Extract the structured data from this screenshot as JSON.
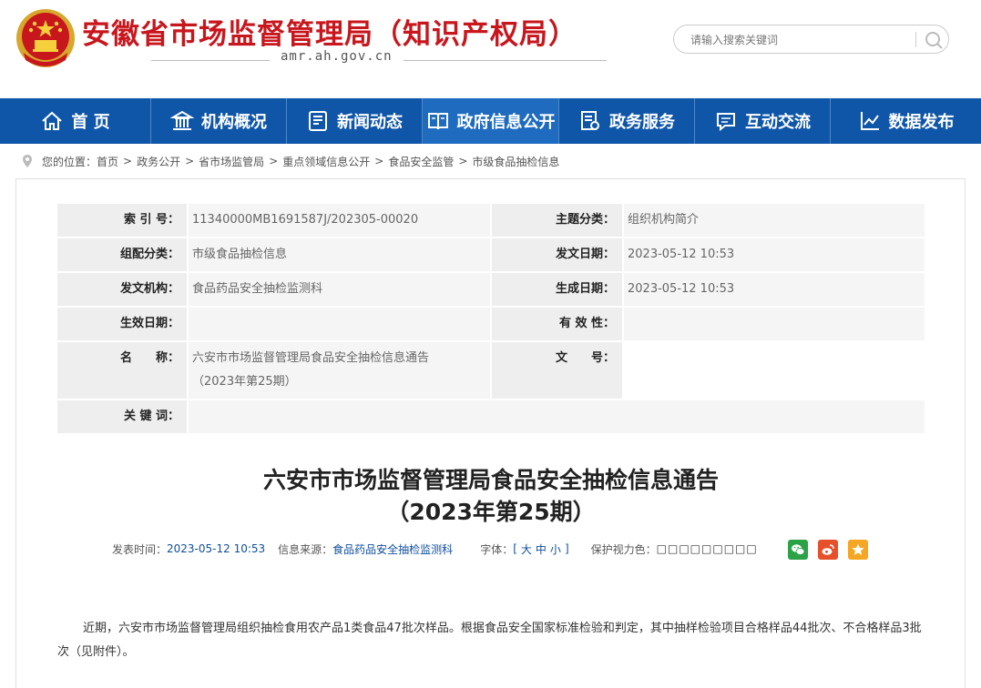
{
  "header": {
    "title": "安徽省市场监督管理局（知识产权局）",
    "domain": "amr.ah.gov.cn",
    "search_placeholder": "请输入搜索关键词",
    "brand_color": "#c8161d"
  },
  "nav": {
    "color": "#0f56a9",
    "items": [
      {
        "label": "首 页",
        "icon": "home-icon"
      },
      {
        "label": "机构概况",
        "icon": "building-icon"
      },
      {
        "label": "新闻动态",
        "icon": "news-icon"
      },
      {
        "label": "政府信息公开",
        "icon": "book-icon"
      },
      {
        "label": "政务服务",
        "icon": "document-icon"
      },
      {
        "label": "互动交流",
        "icon": "chat-icon"
      },
      {
        "label": "数据发布",
        "icon": "chart-icon"
      }
    ]
  },
  "breadcrumb": {
    "prefix": "您的位置：",
    "items": [
      "首页",
      "政务公开",
      "省市场监管局",
      "重点领域信息公开",
      "食品安全监管",
      "市级食品抽检信息"
    ]
  },
  "meta": {
    "index_label": "索 引 号：",
    "index_value": "11340000MB1691587J/202305-00020",
    "topic_label": "主题分类：",
    "topic_value": "组织机构简介",
    "category_label": "组配分类：",
    "category_value": "市级食品抽检信息",
    "date_label": "发文日期：",
    "date_value": "2023-05-12 10:53",
    "org_label": "发文机构：",
    "org_value": "食品药品安全抽检监测科",
    "created_label": "生成日期：",
    "created_value": "2023-05-12 10:53",
    "effective_label": "生效日期：",
    "effective_value": "",
    "validity_label": "有 效 性：",
    "validity_value": "",
    "name_label": "名　　称：",
    "name_line1": "六安市市场监督管理局食品安全抽检信息通告",
    "name_line2": "（2023年第25期）",
    "docno_label": "文　　号：",
    "docno_value": "",
    "keywords_label": "关 键 词：",
    "keywords_value": ""
  },
  "article": {
    "title_line1": "六安市市场监督管理局食品安全抽检信息通告",
    "title_line2": "（2023年第25期）",
    "publish_label": "发表时间：",
    "publish_time": "2023-05-12 10:53",
    "source_label": "信息来源：",
    "source": "食品药品安全抽检监测科",
    "font_label": "字体：",
    "font_open": "[",
    "font_large": "大",
    "font_medium": "中",
    "font_small": "小",
    "font_close": "]",
    "vision_label": "保护视力色：",
    "vision_colors": [
      "#FAF9DE",
      "#FFF2E2",
      "#FDE6E0",
      "#F3FFE1",
      "#DAFAF4",
      "#EAEAEF",
      "#FFFFFF",
      "#EDEDED",
      "#E6E6E6"
    ],
    "paragraph": "近期，六安市市场监督管理局组织抽检食用农产品1类食品47批次样品。根据食品安全国家标准检验和判定，其中抽样检验项目合格样品44批次、不合格样品3批次（见附件）。"
  },
  "share": [
    {
      "name": "wechat-share",
      "color": "#2ba245"
    },
    {
      "name": "weibo-share",
      "color": "#e6512c"
    },
    {
      "name": "favorite-share",
      "color": "#f5a623"
    }
  ]
}
